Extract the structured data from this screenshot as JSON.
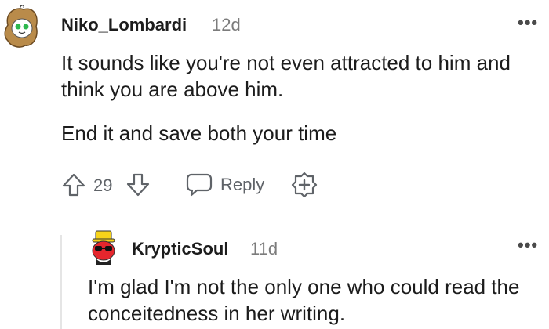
{
  "comments": [
    {
      "username": "Niko_Lombardi",
      "age": "12d",
      "paragraphs": [
        "It sounds like you're not even attracted to him and think you are above him.",
        "End it and save both your time"
      ],
      "vote_count": "29",
      "reply_label": "Reply",
      "more_label": "•••"
    },
    {
      "username": "KrypticSoul",
      "age": "11d",
      "paragraphs": [
        "I'm glad I'm not the only one who could read the conceitedness in her writing."
      ],
      "more_label": "•••"
    }
  ]
}
